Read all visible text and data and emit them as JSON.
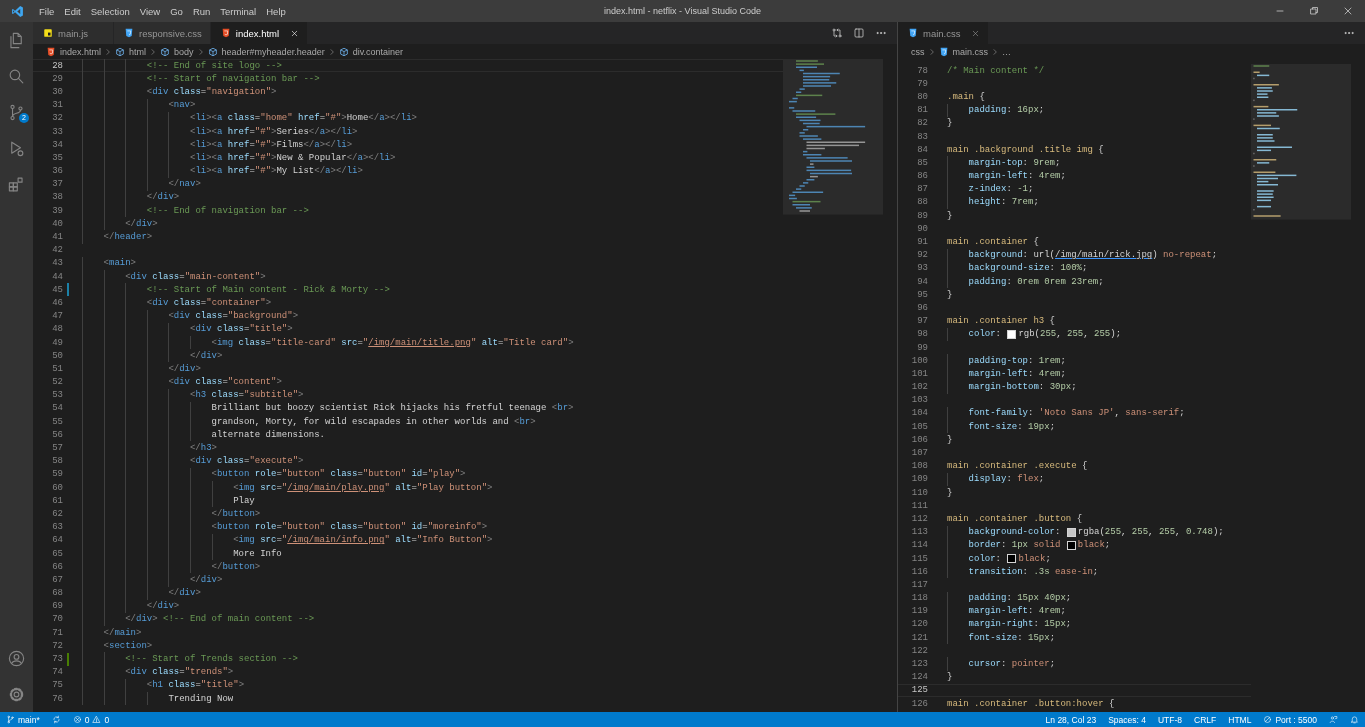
{
  "title_bar": {
    "menu": [
      "File",
      "Edit",
      "Selection",
      "View",
      "Go",
      "Run",
      "Terminal",
      "Help"
    ],
    "title": "index.html - netflix - Visual Studio Code"
  },
  "activity_bar": {
    "top": [
      {
        "kind": "explorer",
        "selected": false
      },
      {
        "kind": "search",
        "selected": false
      },
      {
        "kind": "source_control",
        "selected": false,
        "badge": "2"
      },
      {
        "kind": "run",
        "selected": false
      },
      {
        "kind": "extensions",
        "selected": false
      }
    ],
    "bottom": [
      {
        "kind": "account",
        "selected": false
      },
      {
        "kind": "settings",
        "selected": false
      }
    ]
  },
  "editor_groups": [
    {
      "focused": true,
      "kind": "html",
      "actions": [
        {
          "kind": "compare"
        },
        {
          "kind": "split"
        },
        {
          "kind": "more"
        }
      ],
      "tabs": [
        {
          "label": "main.js",
          "kind": "js",
          "selected": false
        },
        {
          "label": "responsive.css",
          "kind": "css",
          "selected": false
        },
        {
          "label": "index.html",
          "kind": "html",
          "selected": true
        }
      ],
      "breadcrumbs": [
        {
          "label": "index.html",
          "kind": "html"
        },
        {
          "label": "html",
          "kind": "element"
        },
        {
          "label": "body",
          "kind": "element"
        },
        {
          "label": "header#myheader.header",
          "kind": "element"
        },
        {
          "label": "div.container",
          "kind": "element"
        }
      ],
      "lines": [
        {
          "n": "28",
          "code": "            <!-- End of site logo -->",
          "current": true
        },
        {
          "n": "29",
          "code": "            <!-- Start of navigation bar -->",
          "current": false
        },
        {
          "n": "30",
          "code": "            <div class=\"navigation\">",
          "current": false
        },
        {
          "n": "31",
          "code": "                <nav>",
          "current": false
        },
        {
          "n": "32",
          "code": "                    <li><a class=\"home\" href=\"#\">Home</a></li>",
          "current": false
        },
        {
          "n": "33",
          "code": "                    <li><a href=\"#\">Series</a></li>",
          "current": false
        },
        {
          "n": "34",
          "code": "                    <li><a href=\"#\">Films</a></li>",
          "current": false
        },
        {
          "n": "35",
          "code": "                    <li><a href=\"#\">New & Popular</a></li>",
          "current": false
        },
        {
          "n": "36",
          "code": "                    <li><a href=\"#\">My List</a></li>",
          "current": false
        },
        {
          "n": "37",
          "code": "                </nav>",
          "current": false
        },
        {
          "n": "38",
          "code": "            </div>",
          "current": false
        },
        {
          "n": "39",
          "code": "            <!-- End of navigation bar -->",
          "current": false
        },
        {
          "n": "40",
          "code": "        </div>",
          "current": false
        },
        {
          "n": "41",
          "code": "    </header>",
          "current": false
        },
        {
          "n": "42",
          "current": false
        },
        {
          "n": "43",
          "code": "    <main>",
          "current": false
        },
        {
          "n": "44",
          "code": "        <div class=\"main-content\">",
          "current": false
        },
        {
          "n": "45",
          "code": "            <!-- Start of Main content - Rick & Morty -->",
          "current": false,
          "marker": {
            "color": "#1b81a8"
          }
        },
        {
          "n": "46",
          "code": "            <div class=\"container\">",
          "current": false
        },
        {
          "n": "47",
          "code": "                <div class=\"background\">",
          "current": false
        },
        {
          "n": "48",
          "code": "                    <div class=\"title\">",
          "current": false
        },
        {
          "n": "49",
          "code": "                        <img class=\"title-card\" src=\"/img/main/title.png\" alt=\"Title card\">",
          "current": false
        },
        {
          "n": "50",
          "code": "                    </div>",
          "current": false
        },
        {
          "n": "51",
          "code": "                </div>",
          "current": false
        },
        {
          "n": "52",
          "code": "                <div class=\"content\">",
          "current": false
        },
        {
          "n": "53",
          "code": "                    <h3 class=\"subtitle\">",
          "current": false
        },
        {
          "n": "54",
          "code": "                        Brilliant but boozy scientist Rick hijacks his fretful teenage <br>",
          "current": false
        },
        {
          "n": "55",
          "code": "                        grandson, Morty, for wild escapades in other worlds and <br>",
          "current": false
        },
        {
          "n": "56",
          "code": "                        alternate dimensions.",
          "current": false
        },
        {
          "n": "57",
          "code": "                    </h3>",
          "current": false
        },
        {
          "n": "58",
          "code": "                    <div class=\"execute\">",
          "current": false
        },
        {
          "n": "59",
          "code": "                        <button role=\"button\" class=\"button\" id=\"play\">",
          "current": false
        },
        {
          "n": "60",
          "code": "                            <img src=\"/img/main/play.png\" alt=\"Play button\">",
          "current": false
        },
        {
          "n": "61",
          "code": "                            Play",
          "current": false
        },
        {
          "n": "62",
          "code": "                        </button>",
          "current": false
        },
        {
          "n": "63",
          "code": "                        <button role=\"button\" class=\"button\" id=\"moreinfo\">",
          "current": false
        },
        {
          "n": "64",
          "code": "                            <img src=\"/img/main/info.png\" alt=\"Info Button\">",
          "current": false
        },
        {
          "n": "65",
          "code": "                            More Info",
          "current": false
        },
        {
          "n": "66",
          "code": "                        </button>",
          "current": false
        },
        {
          "n": "67",
          "code": "                    </div>",
          "current": false
        },
        {
          "n": "68",
          "code": "                </div>",
          "current": false
        },
        {
          "n": "69",
          "code": "            </div>",
          "current": false
        },
        {
          "n": "70",
          "code": "        </div> <!-- End of main content -->",
          "current": false
        },
        {
          "n": "71",
          "code": "    </main>",
          "current": false
        },
        {
          "n": "72",
          "code": "    <section>",
          "current": false
        },
        {
          "n": "73",
          "code": "        <!-- Start of Trends section -->",
          "current": false,
          "marker": {
            "color": "#487e02"
          }
        },
        {
          "n": "74",
          "code": "        <div class=\"trends\">",
          "current": false
        },
        {
          "n": "75",
          "code": "            <h1 class=\"title\">",
          "current": false
        },
        {
          "n": "76",
          "code": "                Trending Now",
          "current": false
        }
      ]
    },
    {
      "focused": false,
      "kind": "css",
      "actions": [
        {
          "kind": "more"
        }
      ],
      "tabs": [
        {
          "label": "main.css",
          "kind": "css",
          "selected": true
        }
      ],
      "breadcrumbs": [
        {
          "label": "css",
          "kind": "folder"
        },
        {
          "label": "main.css",
          "kind": "css"
        },
        {
          "label": "…",
          "kind": "more"
        }
      ],
      "lines": [
        {
          "n": "78",
          "code": "/* Main content */",
          "current": false
        },
        {
          "n": "79",
          "current": false
        },
        {
          "n": "80",
          "code": ".main {",
          "current": false
        },
        {
          "n": "81",
          "code": "    padding: 16px;",
          "current": false
        },
        {
          "n": "82",
          "code": "}",
          "current": false
        },
        {
          "n": "83",
          "current": false
        },
        {
          "n": "84",
          "code": "main .background .title img {",
          "current": false
        },
        {
          "n": "85",
          "code": "    margin-top: 9rem;",
          "current": false
        },
        {
          "n": "86",
          "code": "    margin-left: 4rem;",
          "current": false
        },
        {
          "n": "87",
          "code": "    z-index: -1;",
          "current": false
        },
        {
          "n": "88",
          "code": "    height: 7rem;",
          "current": false
        },
        {
          "n": "89",
          "code": "}",
          "current": false
        },
        {
          "n": "90",
          "current": false
        },
        {
          "n": "91",
          "code": "main .container {",
          "current": false
        },
        {
          "n": "92",
          "code": "    background: url(/img/main/rick.jpg) no-repeat;",
          "current": false
        },
        {
          "n": "93",
          "code": "    background-size: 100%;",
          "current": false
        },
        {
          "n": "94",
          "code": "    padding: 0rem 0rem 23rem;",
          "current": false
        },
        {
          "n": "95",
          "code": "}",
          "current": false
        },
        {
          "n": "96",
          "current": false
        },
        {
          "n": "97",
          "code": "main .container h3 {",
          "current": false
        },
        {
          "n": "98",
          "code": "    color: rgb(255, 255, 255);",
          "current": false
        },
        {
          "n": "99",
          "current": false
        },
        {
          "n": "100",
          "code": "    padding-top: 1rem;",
          "current": false
        },
        {
          "n": "101",
          "code": "    margin-left: 4rem;",
          "current": false
        },
        {
          "n": "102",
          "code": "    margin-bottom: 30px;",
          "current": false
        },
        {
          "n": "103",
          "current": false
        },
        {
          "n": "104",
          "code": "    font-family: 'Noto Sans JP', sans-serif;",
          "current": false
        },
        {
          "n": "105",
          "code": "    font-size: 19px;",
          "current": false
        },
        {
          "n": "106",
          "code": "}",
          "current": false
        },
        {
          "n": "107",
          "current": false
        },
        {
          "n": "108",
          "code": "main .container .execute {",
          "current": false
        },
        {
          "n": "109",
          "code": "    display: flex;",
          "current": false
        },
        {
          "n": "110",
          "code": "}",
          "current": false
        },
        {
          "n": "111",
          "current": false
        },
        {
          "n": "112",
          "code": "main .container .button {",
          "current": false
        },
        {
          "n": "113",
          "code": "    background-color: rgba(255, 255, 255, 0.748);",
          "current": false
        },
        {
          "n": "114",
          "code": "    border: 1px solid black;",
          "current": false
        },
        {
          "n": "115",
          "code": "    color: black;",
          "current": false
        },
        {
          "n": "116",
          "code": "    transition: .3s ease-in;",
          "current": false
        },
        {
          "n": "117",
          "current": false
        },
        {
          "n": "118",
          "code": "    padding: 15px 40px;",
          "current": false
        },
        {
          "n": "119",
          "code": "    margin-left: 4rem;",
          "current": false
        },
        {
          "n": "120",
          "code": "    margin-right: 15px;",
          "current": false
        },
        {
          "n": "121",
          "code": "    font-size: 15px;",
          "current": false
        },
        {
          "n": "122",
          "current": false
        },
        {
          "n": "123",
          "code": "    cursor: pointer;",
          "current": false
        },
        {
          "n": "124",
          "code": "}",
          "current": false
        },
        {
          "n": "125",
          "current": true
        },
        {
          "n": "126",
          "code": "main .container .button:hover {",
          "current": false
        }
      ]
    }
  ],
  "status_bar": {
    "left": [
      {
        "kind": "branch",
        "label": "main*"
      },
      {
        "kind": "sync"
      },
      {
        "kind": "problems",
        "errors": "0",
        "warnings": "0"
      }
    ],
    "right": [
      {
        "kind": "text",
        "label": "Ln 28, Col 23"
      },
      {
        "kind": "text",
        "label": "Spaces: 4"
      },
      {
        "kind": "text",
        "label": "UTF-8"
      },
      {
        "kind": "text",
        "label": "CRLF"
      },
      {
        "kind": "text",
        "label": "HTML"
      },
      {
        "kind": "port",
        "label": "Port : 5500"
      },
      {
        "kind": "feedback"
      },
      {
        "kind": "notifications"
      }
    ]
  }
}
